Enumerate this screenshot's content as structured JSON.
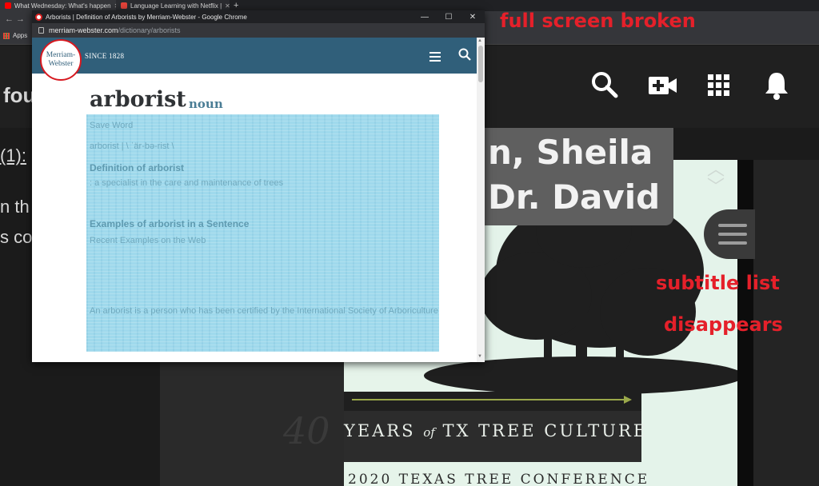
{
  "bg_browser": {
    "tabs": [
      {
        "title": "What Wednesday: What's happen",
        "favicon_color": "#ff0000"
      },
      {
        "title": "Language Learning with Netflix |",
        "favicon_color": "#e4433a"
      }
    ],
    "new_tab_label": "+",
    "bookmarks_apps_label": "Apps"
  },
  "bg_site": {
    "left_partial_1": "fou",
    "left_partial_2": "(1):",
    "left_partial_3": "n th",
    "left_partial_4": "s co",
    "icons": [
      "search-icon",
      "add-video-icon",
      "apps-grid-icon",
      "bell-icon"
    ]
  },
  "video": {
    "subtitle_line1": "n, Sheila",
    "subtitle_line2": "Dr. David",
    "banner_years": "40",
    "banner_text_pre": "YEARS ",
    "banner_text_of": "of",
    "banner_text_post": " TX TREE CULTURE",
    "conference_text": "2020 TEXAS TREE CONFERENCE"
  },
  "annotations": {
    "full_screen_broken": "full screen broken",
    "subtitle_list": "subtitle list",
    "disappears": "disappears",
    "color": "#e5202a"
  },
  "popup": {
    "window_title": "Arborists | Definition of Arborists by Merriam-Webster - Google Chrome",
    "url_host": "merriam-webster.com",
    "url_path": "/dictionary/arborists",
    "logo_line1": "Merriam-",
    "logo_line2": "Webster",
    "since_label": "SINCE 1828",
    "headword": "arborist",
    "part_of_speech": "noun",
    "brand_color": "#305f7a",
    "blurred_lines": [
      "Save Word",
      "arborist | \\ ˈär-bə-rist \\",
      "Definition of arborist",
      ": a specialist in the care and maintenance of trees",
      "Examples of arborist in a Sentence",
      "Recent Examples on the Web",
      "An arborist is a person who has been certified by the International Society of Arboriculture"
    ]
  }
}
